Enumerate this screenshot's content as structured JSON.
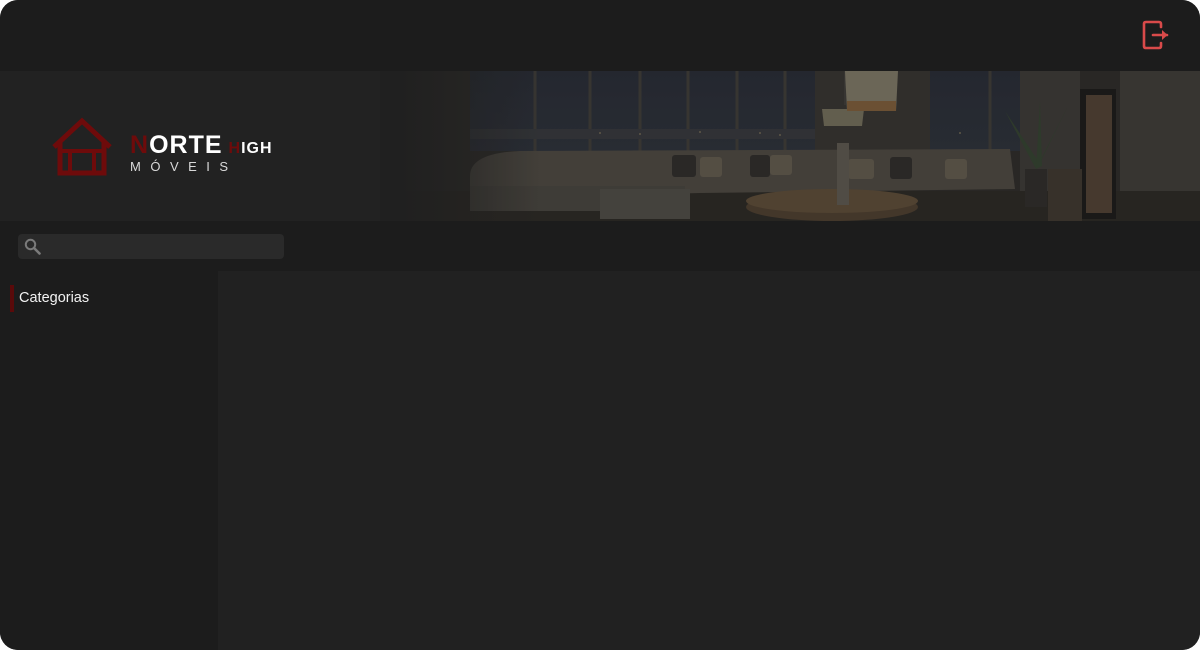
{
  "header": {
    "logout_icon": "logout-icon",
    "accent_color": "#d94a4a"
  },
  "banner": {
    "logo": {
      "icon": "house-icon",
      "brand_main_initial": "N",
      "brand_main_rest": "ORTE",
      "brand_secondary_initial": "H",
      "brand_secondary_rest": "IGH",
      "tagline": "MÓVEIS",
      "brand_color": "#6e0b0b"
    },
    "image": "living-room-night-scene"
  },
  "search": {
    "icon": "search-icon",
    "placeholder": "",
    "value": ""
  },
  "sidebar": {
    "categories_label": "Categorias",
    "accent_color": "#5a0a0a"
  },
  "colors": {
    "background": "#1c1c1c",
    "content": "#212121",
    "text": "#f2f2f2"
  }
}
